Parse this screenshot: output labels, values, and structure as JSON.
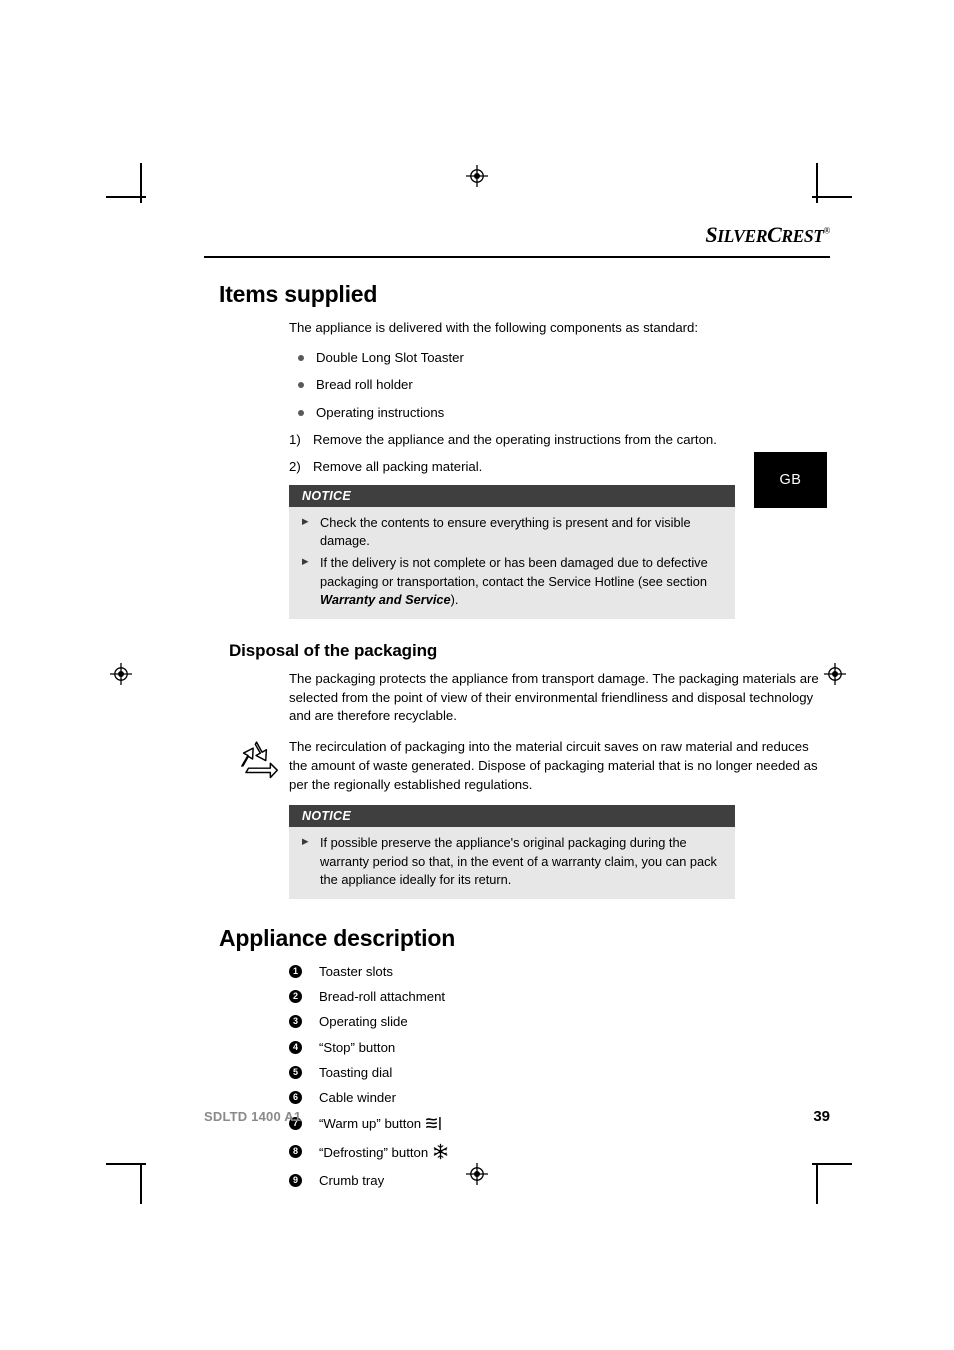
{
  "brand": {
    "logo_silver": "SILVER",
    "logo_crest": "CREST",
    "registered_mark": "®"
  },
  "lang_tab": {
    "label": "GB"
  },
  "sections": {
    "items_supplied": {
      "heading": "Items supplied",
      "intro": "The appliance is delivered with the following components as standard:",
      "bullets": [
        "Double Long Slot Toaster",
        "Bread roll holder",
        "Operating instructions"
      ],
      "steps": [
        {
          "num": "1)",
          "text": "Remove the appliance and the operating instructions from the carton."
        },
        {
          "num": "2)",
          "text": "Remove all packing material."
        }
      ],
      "notice": {
        "title": "NOTICE",
        "items": [
          {
            "text": "Check the contents to ensure everything is present and for visible damage."
          }
        ],
        "item2_pre": "If the delivery is not complete or has been damaged due to defective packaging or transportation, contact the Service Hotline (see section ",
        "item2_bold": "Warranty and Service",
        "item2_post": ")."
      }
    },
    "disposal": {
      "heading": "Disposal of the packaging",
      "para1": "The packaging protects the appliance from transport damage. The packaging materials are selected from the point of view of their environmental friendliness and disposal technology and are therefore recyclable.",
      "para2": "The recirculation of packaging into the material circuit saves on raw material and reduces the amount of waste generated. Dispose of packaging material that is no longer needed as per the regionally established regulations.",
      "notice": {
        "title": "NOTICE",
        "item1": "If possible preserve the appliance's original packaging during the warranty period so that, in the event of a warranty claim, you can pack the appliance ideally for its return."
      }
    },
    "appliance_description": {
      "heading": "Appliance description",
      "parts": [
        {
          "num": "1",
          "label": "Toaster slots",
          "icon": null
        },
        {
          "num": "2",
          "label": "Bread-roll attachment",
          "icon": null
        },
        {
          "num": "3",
          "label": "Operating slide",
          "icon": null
        },
        {
          "num": "4",
          "label": "“Stop” button",
          "icon": null
        },
        {
          "num": "5",
          "label": "Toasting dial",
          "icon": null
        },
        {
          "num": "6",
          "label": "Cable winder",
          "icon": null
        },
        {
          "num": "7",
          "label": "“Warm up” button",
          "icon": "warm-up-icon"
        },
        {
          "num": "8",
          "label": "“Defrosting” button",
          "icon": "defrost-snowflake-icon"
        },
        {
          "num": "9",
          "label": "Crumb tray",
          "icon": null
        }
      ]
    }
  },
  "footer": {
    "model": "SDLTD 1400 A1",
    "page_number": "39"
  },
  "colors": {
    "notice_header_bg": "#3f3f3f",
    "notice_body_bg": "#e7e7e7",
    "lang_tab_bg": "#000000",
    "bullet": "#595959",
    "footer_model": "#8a8a8a"
  }
}
